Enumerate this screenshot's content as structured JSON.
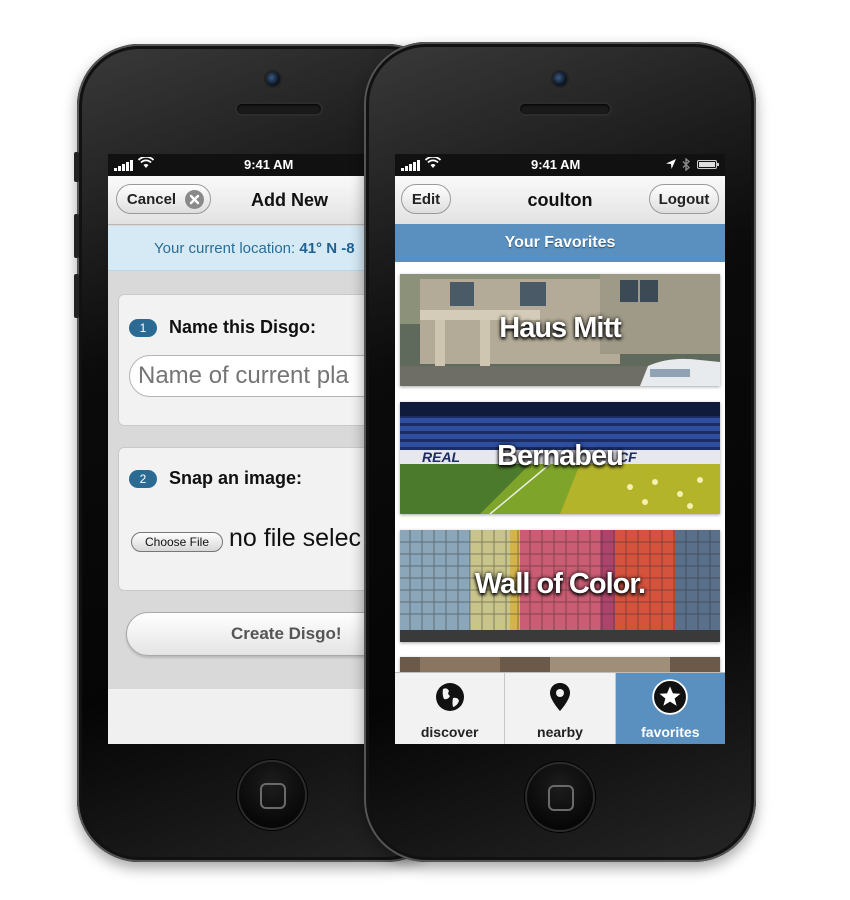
{
  "left_phone": {
    "status": {
      "time": "9:41 AM"
    },
    "nav": {
      "cancel_label": "Cancel",
      "title": "Add New"
    },
    "location": {
      "prefix": "Your current location: ",
      "value": "41° N -8"
    },
    "step1": {
      "number": "1",
      "label": "Name this Disgo:",
      "placeholder": "Name of current pla"
    },
    "step2": {
      "number": "2",
      "label": "Snap an image:",
      "choose_file_label": "Choose File",
      "file_status": "no file selec"
    },
    "create_button_label": "Create Disgo!"
  },
  "right_phone": {
    "status": {
      "time": "9:41 AM"
    },
    "nav": {
      "edit_label": "Edit",
      "title": "coulton",
      "logout_label": "Logout"
    },
    "section_title": "Your Favorites",
    "favorites": [
      {
        "title": "Haus Mitt"
      },
      {
        "title": "Bernabeu"
      },
      {
        "title": "Wall of Color."
      }
    ],
    "stadium_sign": {
      "left": "REAL",
      "right": "CF"
    },
    "tabs": [
      {
        "label": "discover",
        "icon": "globe-icon",
        "active": false
      },
      {
        "label": "nearby",
        "icon": "map-pin-icon",
        "active": false
      },
      {
        "label": "favorites",
        "icon": "star-icon",
        "active": true
      }
    ]
  },
  "colors": {
    "accent_blue": "#5a90c0",
    "step_badge": "#2b6a93",
    "location_bg": "#d6eaf5"
  }
}
